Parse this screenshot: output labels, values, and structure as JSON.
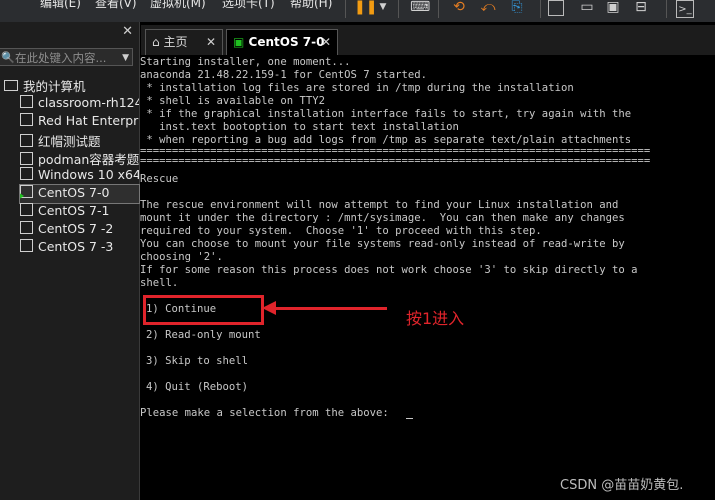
{
  "menubar": {
    "items": [
      "编辑(E)",
      "查看(V)",
      "虚拟机(M)",
      "选项卡(T)",
      "帮助(H)"
    ]
  },
  "sidebar": {
    "search_placeholder": "在此处键入内容...",
    "root_label": "我的计算机",
    "items": [
      {
        "label": "classroom-rh124"
      },
      {
        "label": "Red Hat Enterprise"
      },
      {
        "label": "红帽测试题"
      },
      {
        "label": "podman容器考题"
      },
      {
        "label": "Windows 10 x64"
      },
      {
        "label": "CentOS 7-0",
        "selected": true,
        "running": true
      },
      {
        "label": "CentOS 7-1"
      },
      {
        "label": "CentOS 7 -2"
      },
      {
        "label": "CentOS 7 -3"
      }
    ]
  },
  "tabs": {
    "home_label": "主页",
    "active_label": "CentOS 7-0"
  },
  "terminal": {
    "lines": [
      "Starting installer, one moment...",
      "anaconda 21.48.22.159-1 for CentOS 7 started.",
      " * installation log files are stored in /tmp during the installation",
      " * shell is available on TTY2",
      " * if the graphical installation interface fails to start, try again with the",
      "   inst.text bootoption to start text installation",
      " * when reporting a bug add logs from /tmp as separate text/plain attachments",
      "================================================================================",
      "================================================================================",
      "Rescue",
      "",
      "The rescue environment will now attempt to find your Linux installation and",
      "mount it under the directory : /mnt/sysimage.  You can then make any changes",
      "required to your system.  Choose '1' to proceed with this step.",
      "You can choose to mount your file systems read-only instead of read-write by",
      "choosing '2'.",
      "If for some reason this process does not work choose '3' to skip directly to a",
      "shell.",
      "",
      "1) Continue",
      "",
      "2) Read-only mount",
      "",
      "3) Skip to shell",
      "",
      "4) Quit (Reboot)",
      "",
      "Please make a selection from the above:"
    ]
  },
  "annotation": {
    "text": "按1进入",
    "color": "#e0242b"
  },
  "watermark": "CSDN @苗苗奶黄包."
}
